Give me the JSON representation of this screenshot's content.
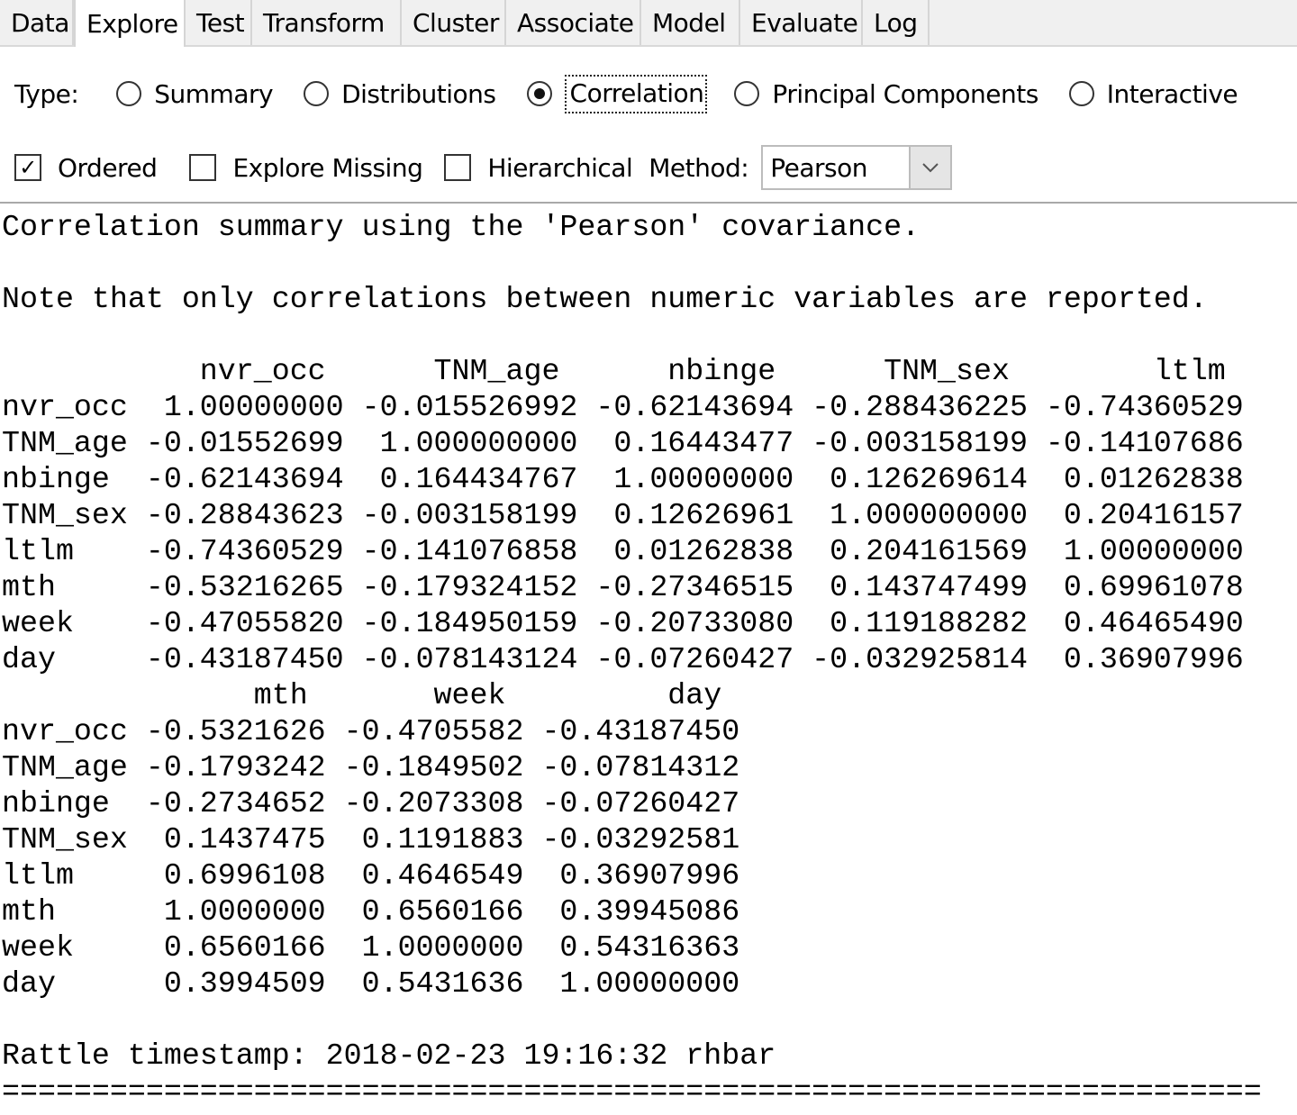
{
  "tabs": [
    "Data",
    "Explore",
    "Test",
    "Transform",
    "Cluster",
    "Associate",
    "Model",
    "Evaluate",
    "Log"
  ],
  "active_tab": "Explore",
  "type_row": {
    "label": "Type:",
    "options": [
      "Summary",
      "Distributions",
      "Correlation",
      "Principal Components",
      "Interactive"
    ],
    "selected": "Correlation"
  },
  "options_row": {
    "ordered": {
      "label": "Ordered",
      "checked": true
    },
    "explore_missing": {
      "label": "Explore Missing",
      "checked": false
    },
    "hierarchical": {
      "label": "Hierarchical",
      "checked": false
    },
    "method_label": "Method:",
    "method_value": "Pearson"
  },
  "output": {
    "lines": [
      "Correlation summary using the 'Pearson' covariance.",
      "",
      "Note that only correlations between numeric variables are reported.",
      "",
      "           nvr_occ      TNM_age      nbinge      TNM_sex        ltlm",
      "nvr_occ  1.00000000 -0.015526992 -0.62143694 -0.288436225 -0.74360529",
      "TNM_age -0.01552699  1.000000000  0.16443477 -0.003158199 -0.14107686",
      "nbinge  -0.62143694  0.164434767  1.00000000  0.126269614  0.01262838",
      "TNM_sex -0.28843623 -0.003158199  0.12626961  1.000000000  0.20416157",
      "ltlm    -0.74360529 -0.141076858  0.01262838  0.204161569  1.00000000",
      "mth     -0.53216265 -0.179324152 -0.27346515  0.143747499  0.69961078",
      "week    -0.47055820 -0.184950159 -0.20733080  0.119188282  0.46465490",
      "day     -0.43187450 -0.078143124 -0.07260427 -0.032925814  0.36907996",
      "              mth       week         day",
      "nvr_occ -0.5321626 -0.4705582 -0.43187450",
      "TNM_age -0.1793242 -0.1849502 -0.07814312",
      "nbinge  -0.2734652 -0.2073308 -0.07260427",
      "TNM_sex  0.1437475  0.1191883 -0.03292581",
      "ltlm     0.6996108  0.4646549  0.36907996",
      "mth      1.0000000  0.6560166  0.39945086",
      "week     0.6560166  1.0000000  0.54316363",
      "day      0.3994509  0.5431636  1.00000000",
      "",
      "Rattle timestamp: 2018-02-23 19:16:32 rhbar",
      "======================================================================"
    ]
  }
}
